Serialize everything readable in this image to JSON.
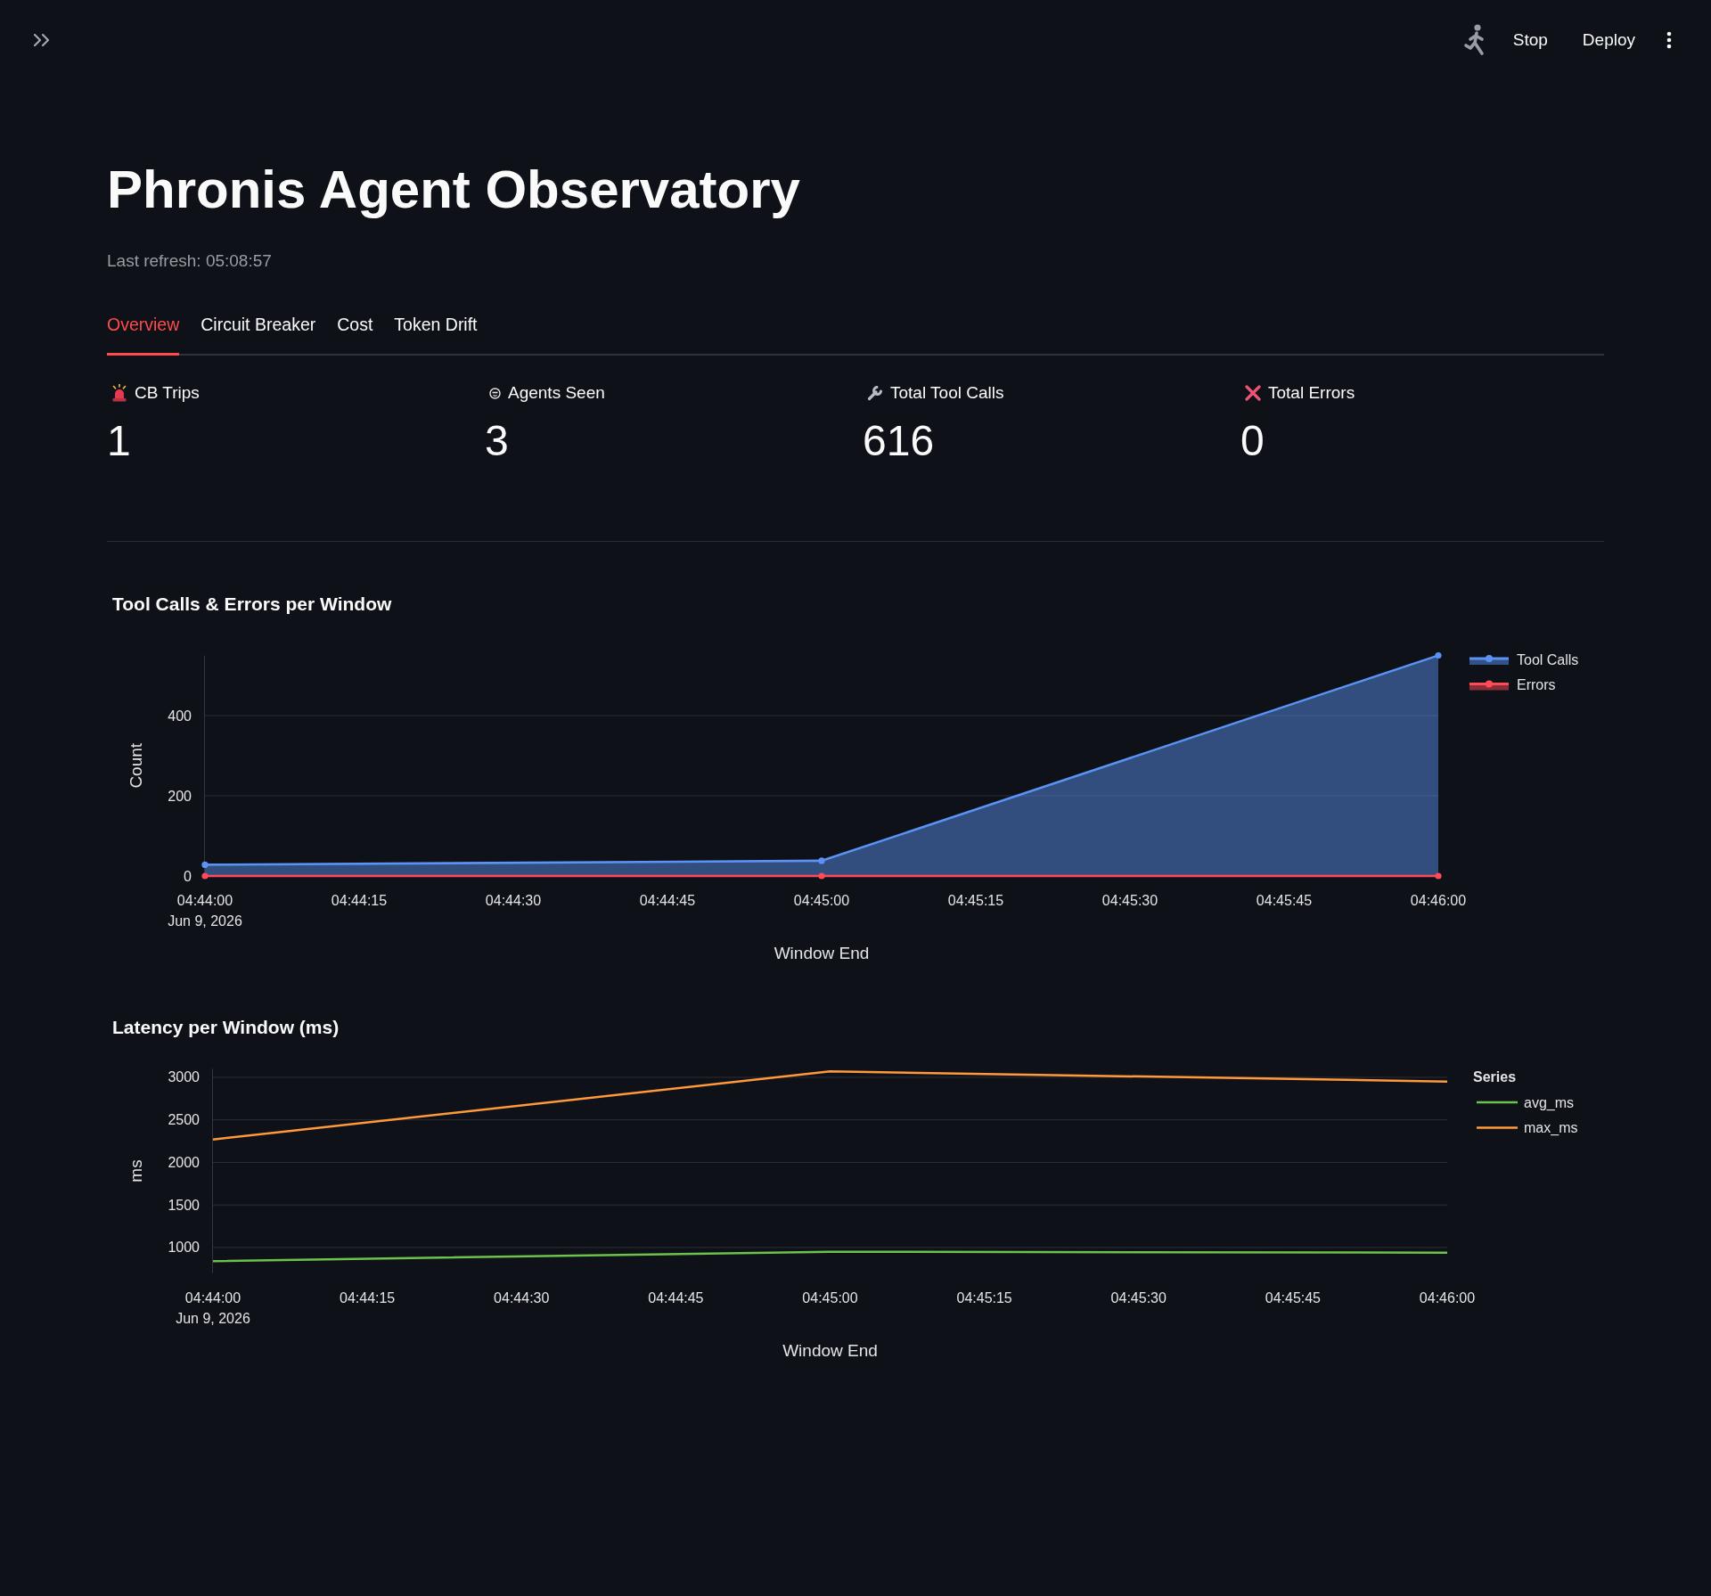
{
  "toolbar": {
    "buttons": [
      {
        "label": "Stop"
      },
      {
        "label": "Deploy"
      }
    ]
  },
  "header": {
    "title": "Phronis Agent Observatory",
    "subtitle": "Last refresh: 05:08:57"
  },
  "tabs": [
    {
      "label": "Overview",
      "selected": true
    },
    {
      "label": "Circuit Breaker",
      "selected": false
    },
    {
      "label": "Cost",
      "selected": false
    },
    {
      "label": "Token Drift",
      "selected": false
    }
  ],
  "metrics": [
    {
      "kind": "siren",
      "label": "CB Trips",
      "value": "1"
    },
    {
      "kind": "face",
      "label": "Agents Seen",
      "value": "3"
    },
    {
      "kind": "wrench",
      "label": "Total Tool Calls",
      "value": "616"
    },
    {
      "kind": "cross",
      "label": "Total Errors",
      "value": "0"
    }
  ],
  "charts": [
    {
      "markers": true,
      "chart_data": {
        "type": "area",
        "title": "Tool Calls & Errors per Window",
        "xlabel": "Window End",
        "ylabel": "Count",
        "categories": [
          "04:44:00\nJun 9, 2026",
          "04:44:15",
          "04:44:30",
          "04:44:45",
          "04:45:00",
          "04:45:15",
          "04:45:30",
          "04:45:45",
          "04:46:00"
        ],
        "series": [
          {
            "name": "Tool Calls",
            "color": "#5b93f5",
            "values": [
              28,
              null,
              null,
              null,
              38,
              null,
              null,
              null,
              550
            ]
          },
          {
            "name": "Errors",
            "color": "#ff4b57",
            "values": [
              0,
              null,
              null,
              null,
              0,
              null,
              null,
              null,
              0
            ]
          }
        ],
        "ylim": [
          0,
          550
        ],
        "yticks": [
          0,
          200,
          400
        ],
        "grid": true,
        "legend": "right"
      }
    },
    {
      "legend_title": "Series",
      "chart_data": {
        "type": "line",
        "title": "Latency per Window (ms)",
        "xlabel": "Window End",
        "ylabel": "ms",
        "categories": [
          "04:44:00\nJun 9, 2026",
          "04:44:15",
          "04:44:30",
          "04:44:45",
          "04:45:00",
          "04:45:15",
          "04:45:30",
          "04:45:45",
          "04:46:00"
        ],
        "series": [
          {
            "name": "avg_ms",
            "color": "#6cc24a",
            "values": [
              840,
              null,
              null,
              null,
              950,
              null,
              null,
              null,
              940
            ]
          },
          {
            "name": "max_ms",
            "color": "#ff9a3c",
            "values": [
              2270,
              null,
              null,
              null,
              3070,
              null,
              null,
              null,
              2950
            ]
          }
        ],
        "ylim": [
          700,
          3100
        ],
        "yticks": [
          1000,
          1500,
          2000,
          2500,
          3000
        ],
        "grid": true,
        "legend": "right"
      }
    }
  ]
}
